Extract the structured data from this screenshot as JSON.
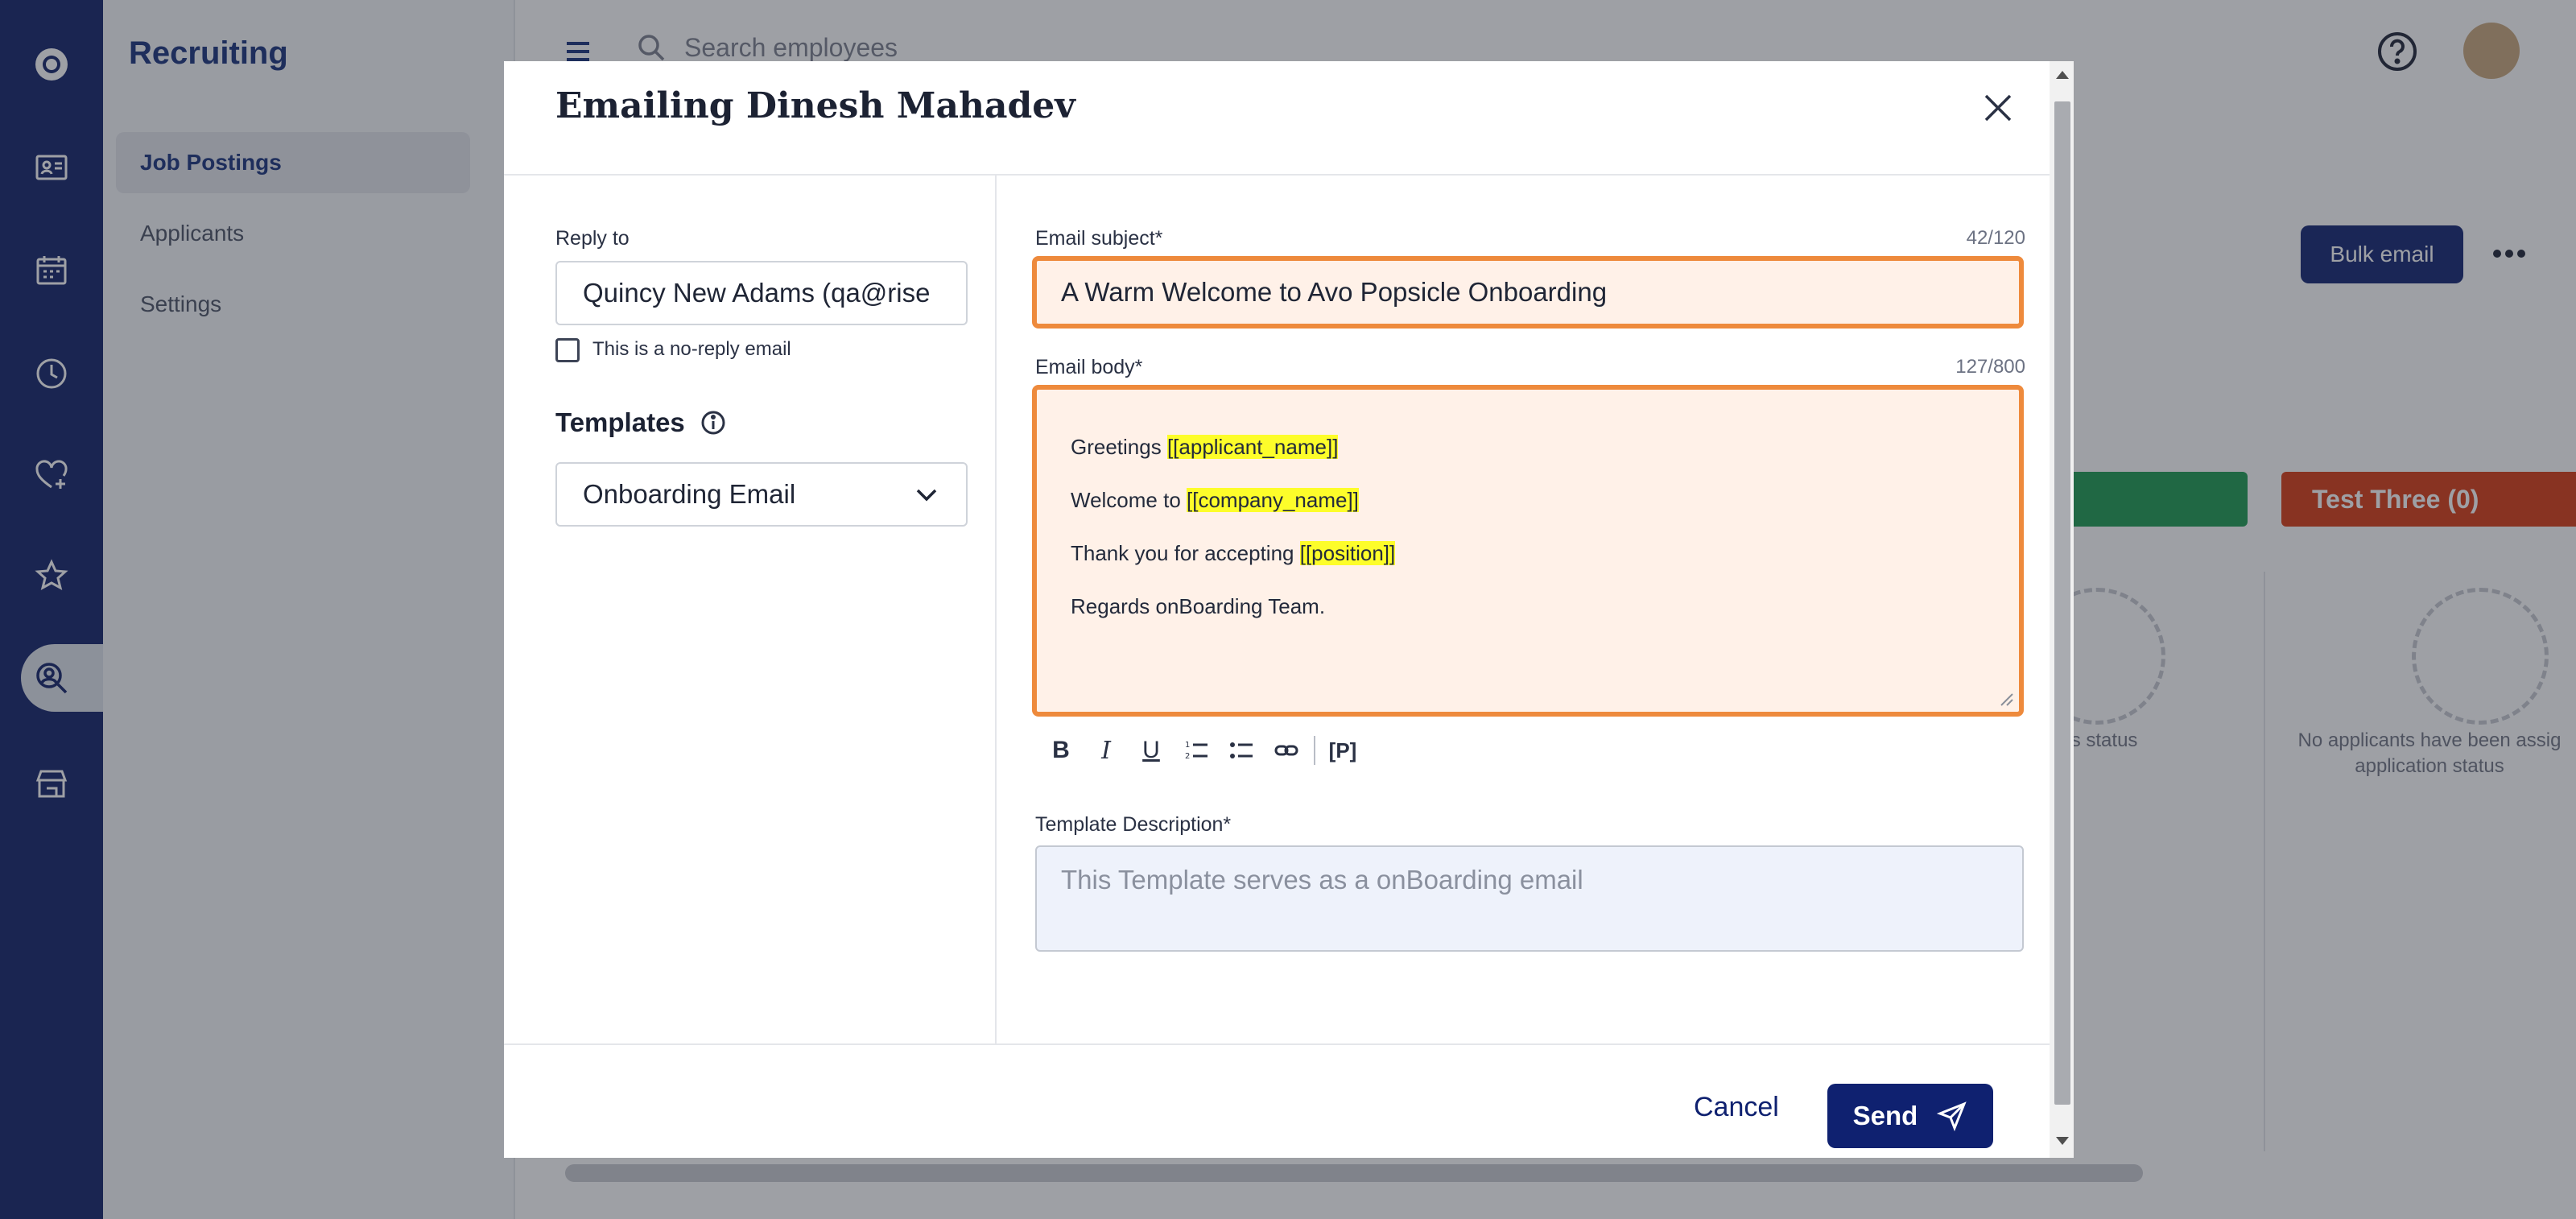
{
  "app": {
    "section_title": "Recruiting",
    "nav_items": [
      {
        "label": "Job Postings",
        "active": true
      },
      {
        "label": "Applicants",
        "active": false
      },
      {
        "label": "Settings",
        "active": false
      }
    ],
    "search_placeholder": "Search employees",
    "bulk_email_label": "Bulk email",
    "statuses": [
      {
        "label": "",
        "color": "#1a9a4f"
      },
      {
        "label": "Test Three (0)",
        "color": "#d83a12"
      }
    ],
    "empty_left": "en assigned to this status",
    "empty_right": "No applicants have been assig application status"
  },
  "modal": {
    "title": "Emailing Dinesh Mahadev",
    "reply_to_label": "Reply to",
    "reply_to_value": "Quincy New Adams (qa@rise",
    "no_reply_label": "This is a no-reply email",
    "templates_label": "Templates",
    "template_selected": "Onboarding Email",
    "subject_label": "Email subject*",
    "subject_count": "42/120",
    "subject_value": "A Warm Welcome to Avo Popsicle Onboarding",
    "body_label": "Email body*",
    "body_count": "127/800",
    "body": {
      "greeting": "Greetings ",
      "applicant_tag": "[[applicant_name]]",
      "welcome": "Welcome to ",
      "company_tag": "[[company_name]]",
      "thanks": "Thank you for accepting ",
      "position_tag": "[[position]]",
      "regards": "Regards onBoarding Team."
    },
    "toolbar": {
      "bold": "B",
      "italic": "I",
      "underline": "U",
      "placeholder": "[P]"
    },
    "description_label": "Template Description*",
    "description_placeholder": "This Template serves as a onBoarding email",
    "cancel_label": "Cancel",
    "send_label": "Send"
  },
  "colors": {
    "primary": "#0f2170",
    "highlight_border": "#ee8a3c",
    "highlight_fill": "#fff1e8",
    "tag_highlight": "#fdfd2a"
  }
}
